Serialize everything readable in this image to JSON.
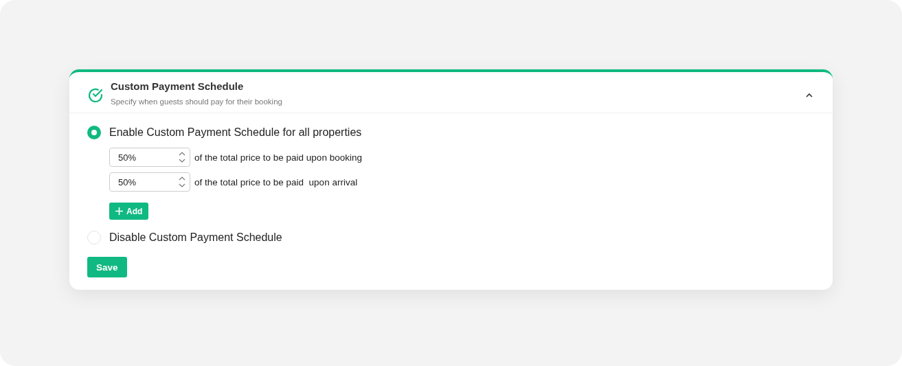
{
  "panel": {
    "title": "Custom Payment Schedule",
    "subtitle": "Specify when guests should pay for their booking",
    "expanded": true
  },
  "options": [
    {
      "label": "Enable Custom Payment Schedule for all properties",
      "selected": true,
      "kind": "schedule"
    },
    {
      "label": "Disable Custom Payment Schedule",
      "selected": false,
      "kind": "plain"
    }
  ],
  "installments": [
    {
      "value": "50%",
      "text": "of the total price to be paid upon booking"
    },
    {
      "value": "50%",
      "text": "of the total price to be paid  upon arrival"
    }
  ],
  "add_button": "Add",
  "save_button": "Save"
}
